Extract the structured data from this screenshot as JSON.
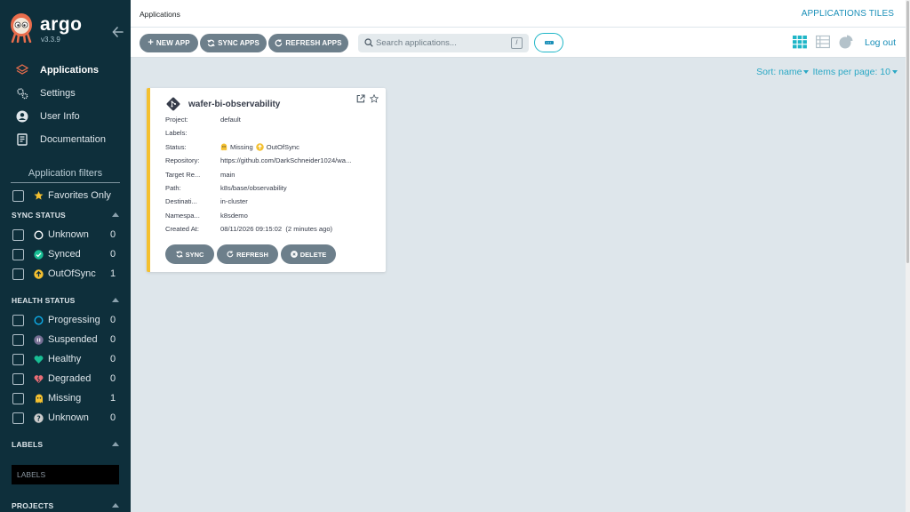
{
  "brand": {
    "name": "argo",
    "version": "v3.3.9"
  },
  "nav": [
    {
      "label": "Applications",
      "icon": "layers-icon"
    },
    {
      "label": "Settings",
      "icon": "gears-icon"
    },
    {
      "label": "User Info",
      "icon": "user-icon"
    },
    {
      "label": "Documentation",
      "icon": "book-icon"
    }
  ],
  "filters": {
    "title": "Application filters",
    "favorites": "Favorites Only",
    "sync_status": {
      "title": "SYNC STATUS",
      "items": [
        {
          "label": "Unknown",
          "count": "0",
          "color": "#ffffff"
        },
        {
          "label": "Synced",
          "count": "0",
          "color": "#18be94"
        },
        {
          "label": "OutOfSync",
          "count": "1",
          "color": "#f4c030"
        }
      ]
    },
    "health_status": {
      "title": "HEALTH STATUS",
      "items": [
        {
          "label": "Progressing",
          "count": "0",
          "color": "#0dadea"
        },
        {
          "label": "Suspended",
          "count": "0",
          "color": "#766f94"
        },
        {
          "label": "Healthy",
          "count": "0",
          "color": "#18be94"
        },
        {
          "label": "Degraded",
          "count": "0",
          "color": "#e96d76"
        },
        {
          "label": "Missing",
          "count": "1",
          "color": "#f4c030"
        },
        {
          "label": "Unknown",
          "count": "0",
          "color": "#cccccc"
        }
      ]
    },
    "labels_title": "LABELS",
    "labels_placeholder": "LABELS",
    "projects_title": "PROJECTS"
  },
  "header": {
    "title": "Applications",
    "view": "APPLICATIONS TILES"
  },
  "toolbar": {
    "new_app": "NEW APP",
    "sync_apps": "SYNC APPS",
    "refresh_apps": "REFRESH APPS",
    "search_placeholder": "Search applications...",
    "search_shortcut": "/",
    "logout": "Log out"
  },
  "sort": {
    "sort_label": "Sort: name",
    "items_label": "Items per page: 10"
  },
  "app_card": {
    "name": "wafer-bi-observability",
    "fields": [
      {
        "key": "Project:",
        "value": "default"
      },
      {
        "key": "Labels:",
        "value": ""
      },
      {
        "key": "Status:",
        "value": "Missing",
        "value2": "OutOfSync"
      },
      {
        "key": "Repository:",
        "value": "https://github.com/DarkSchneider1024/wa..."
      },
      {
        "key": "Target Re...",
        "value": "main"
      },
      {
        "key": "Path:",
        "value": "k8s/base/observability"
      },
      {
        "key": "Destinati...",
        "value": "in-cluster"
      },
      {
        "key": "Namespa...",
        "value": "k8sdemo"
      },
      {
        "key": "Created At:",
        "value": "08/11/2026 09:15:02  (2 minutes ago)"
      }
    ],
    "buttons": {
      "sync": "SYNC",
      "refresh": "REFRESH",
      "delete": "DELETE"
    },
    "accent": "#f4c030"
  }
}
